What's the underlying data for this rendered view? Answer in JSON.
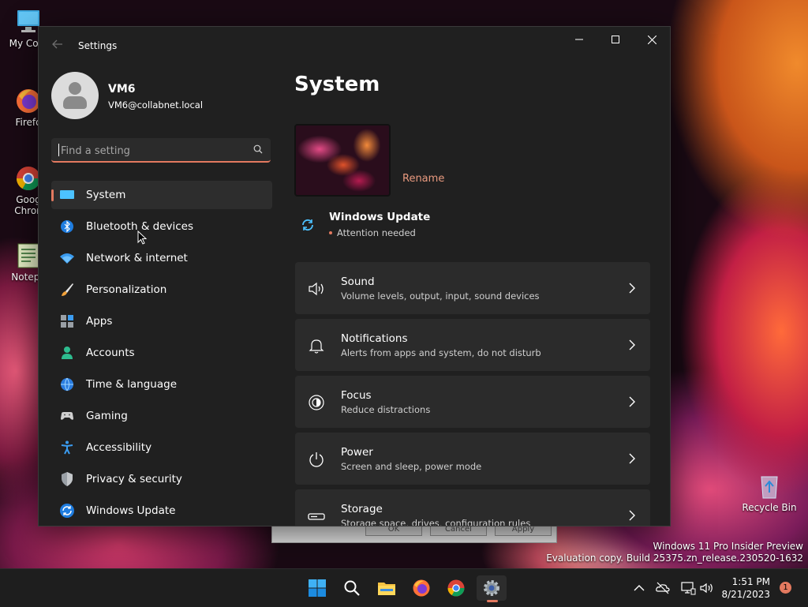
{
  "desktop": {
    "icons": [
      {
        "label": "My Com",
        "icon": "computer-icon"
      },
      {
        "label": "Firefo",
        "icon": "firefox-icon"
      },
      {
        "label": "Goog\nChron",
        "icon": "chrome-icon"
      },
      {
        "label": "Notepa",
        "icon": "notepad-icon"
      },
      {
        "label": "Recycle Bin",
        "icon": "recycle-bin-icon"
      }
    ],
    "watermark": {
      "line1": "Windows 11 Pro Insider Preview",
      "line2": "Evaluation copy. Build 25375.zn_release.230520-1632"
    }
  },
  "window": {
    "title": "Settings",
    "controls": {
      "minimize": "—",
      "maximize": "☐",
      "close": "✕"
    }
  },
  "profile": {
    "name": "VM6",
    "email": "VM6@collabnet.local"
  },
  "search": {
    "placeholder": "Find a setting",
    "value": ""
  },
  "nav": [
    {
      "label": "System",
      "icon": "system-icon",
      "active": true
    },
    {
      "label": "Bluetooth & devices",
      "icon": "bluetooth-icon"
    },
    {
      "label": "Network & internet",
      "icon": "wifi-icon"
    },
    {
      "label": "Personalization",
      "icon": "brush-icon"
    },
    {
      "label": "Apps",
      "icon": "apps-icon"
    },
    {
      "label": "Accounts",
      "icon": "accounts-icon"
    },
    {
      "label": "Time & language",
      "icon": "globe-icon"
    },
    {
      "label": "Gaming",
      "icon": "gamepad-icon"
    },
    {
      "label": "Accessibility",
      "icon": "accessibility-icon"
    },
    {
      "label": "Privacy & security",
      "icon": "shield-icon"
    },
    {
      "label": "Windows Update",
      "icon": "update-icon"
    }
  ],
  "main": {
    "title": "System",
    "rename": "Rename",
    "update": {
      "title": "Windows Update",
      "status": "Attention needed"
    },
    "cards": [
      {
        "title": "Sound",
        "subtitle": "Volume levels, output, input, sound devices",
        "icon": "speaker-icon"
      },
      {
        "title": "Notifications",
        "subtitle": "Alerts from apps and system, do not disturb",
        "icon": "bell-icon"
      },
      {
        "title": "Focus",
        "subtitle": "Reduce distractions",
        "icon": "focus-icon"
      },
      {
        "title": "Power",
        "subtitle": "Screen and sleep, power mode",
        "icon": "power-icon"
      },
      {
        "title": "Storage",
        "subtitle": "Storage space, drives, configuration rules",
        "icon": "storage-icon"
      }
    ]
  },
  "background_dialog": {
    "buttons": [
      "OK",
      "Cancel",
      "Apply"
    ]
  },
  "taskbar": {
    "apps": [
      "start-icon",
      "search-icon",
      "file-explorer-icon",
      "firefox-icon",
      "chrome-icon",
      "settings-icon"
    ],
    "time": "1:51 PM",
    "date": "8/21/2023",
    "notification_count": "1"
  },
  "colors": {
    "accent": "#e3795f",
    "window_bg": "#202020",
    "card_bg": "#2b2b2b"
  }
}
